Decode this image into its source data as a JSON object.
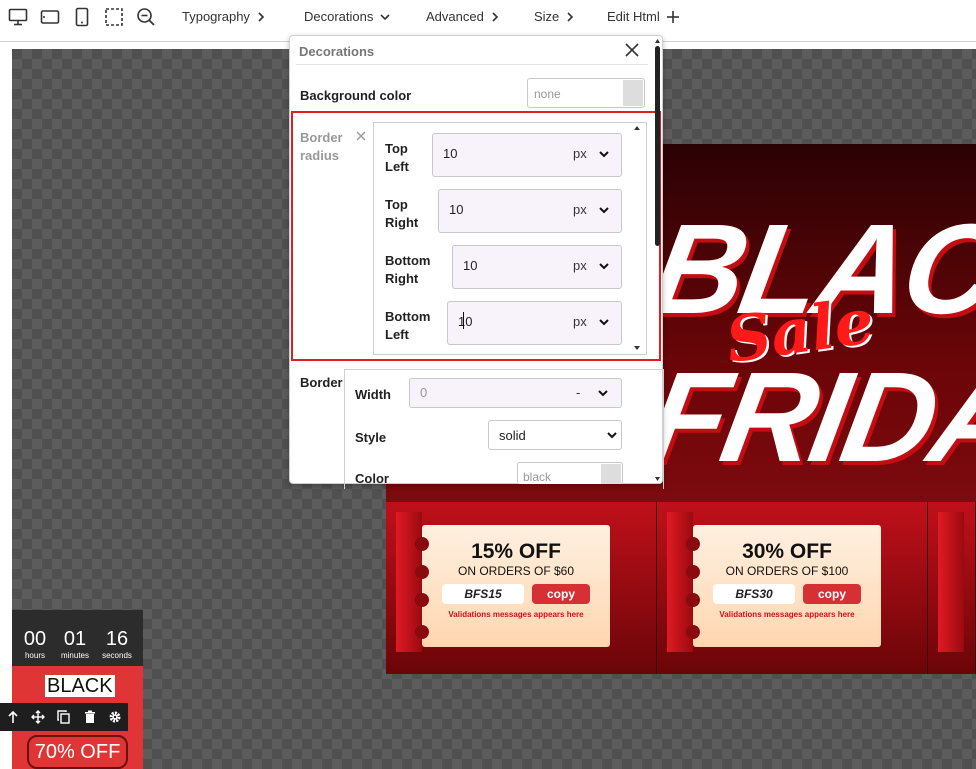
{
  "toolbar": {
    "menus": [
      {
        "label": "Typography",
        "caret": "right"
      },
      {
        "label": "Decorations",
        "caret": "down"
      },
      {
        "label": "Advanced",
        "caret": "right"
      },
      {
        "label": "Size",
        "caret": "right"
      },
      {
        "label": "Edit Html",
        "caret": "plus"
      }
    ]
  },
  "panel": {
    "title": "Decorations",
    "background_color": {
      "label": "Background color",
      "value": "none"
    },
    "border_radius": {
      "label": "Border radius",
      "corners": [
        {
          "label_line1": "Top",
          "label_line2": "Left",
          "value": "10",
          "unit": "px"
        },
        {
          "label_line1": "Top",
          "label_line2": "Right",
          "value": "10",
          "unit": "px"
        },
        {
          "label_line1": "Bottom",
          "label_line2": "Right",
          "value": "10",
          "unit": "px"
        },
        {
          "label_line1": "Bottom",
          "label_line2": "Left",
          "value": "10",
          "unit": "px"
        }
      ]
    },
    "border": {
      "label": "Border",
      "width": {
        "label": "Width",
        "value": "0",
        "unit": "-"
      },
      "style": {
        "label": "Style",
        "value": "solid"
      },
      "color": {
        "label": "Color",
        "value": "black"
      }
    }
  },
  "banner": {
    "word1": "BLACK",
    "word2": "FRIDAY",
    "sale": "Sale",
    "coupons": [
      {
        "off": "15% OFF",
        "on": "ON ORDERS OF $60",
        "code": "BFS15",
        "copy": "copy",
        "valid": "Validations messages appears here"
      },
      {
        "off": "30% OFF",
        "on": "ON ORDERS OF $100",
        "code": "BFS30",
        "copy": "copy",
        "valid": "Validations messages appears here"
      }
    ]
  },
  "preview": {
    "timer": [
      {
        "num": "00",
        "lbl": "hours"
      },
      {
        "num": "01",
        "lbl": "minutes"
      },
      {
        "num": "16",
        "lbl": "seconds"
      }
    ],
    "black": "BLACK",
    "off": "70% OFF"
  }
}
